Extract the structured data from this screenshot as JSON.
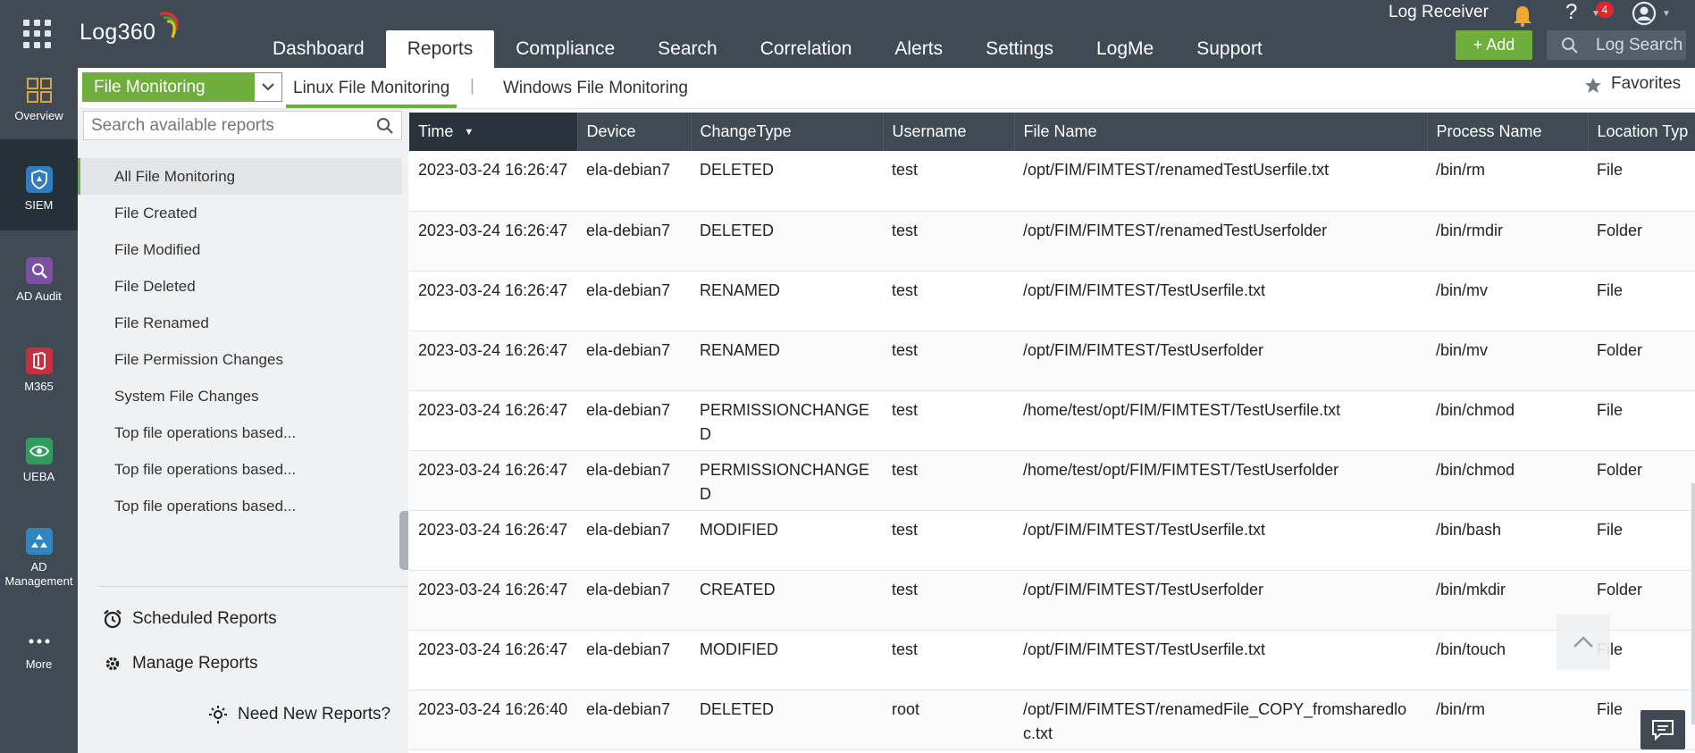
{
  "app": {
    "logo_text": "Log360"
  },
  "rail": {
    "items": [
      {
        "label": "Overview",
        "icon": "overview-icon"
      },
      {
        "label": "SIEM",
        "icon": "siem-icon"
      },
      {
        "label": "AD Audit",
        "icon": "ad-audit-icon"
      },
      {
        "label": "M365",
        "icon": "m365-icon"
      },
      {
        "label": "UEBA",
        "icon": "ueba-icon"
      },
      {
        "label": "AD\nManagement",
        "icon": "ad-management-icon"
      },
      {
        "label": "More",
        "icon": "more-icon"
      }
    ],
    "active": "SIEM"
  },
  "header": {
    "nav": [
      "Dashboard",
      "Reports",
      "Compliance",
      "Search",
      "Correlation",
      "Alerts",
      "Settings",
      "LogMe",
      "Support"
    ],
    "active_nav": "Reports",
    "log_receiver": "Log Receiver",
    "notification_count": "4",
    "help_label": "?",
    "add_label": "Add",
    "log_search_placeholder": "Log Search"
  },
  "subheader": {
    "module": "File Monitoring",
    "tabs": [
      "Linux File Monitoring",
      "Windows File Monitoring"
    ],
    "active_tab": "Linux File Monitoring",
    "favorites": "Favorites"
  },
  "report_panel": {
    "search_placeholder": "Search available reports",
    "reports": [
      "All File Monitoring",
      "File Created",
      "File Modified",
      "File Deleted",
      "File Renamed",
      "File Permission Changes",
      "System File Changes",
      "Top file operations based...",
      "Top file operations based...",
      "Top file operations based..."
    ],
    "active_report": "All File Monitoring",
    "scheduled_reports": "Scheduled Reports",
    "manage_reports": "Manage Reports",
    "need_new_reports": "Need New Reports?"
  },
  "table": {
    "columns": [
      "Time",
      "Device",
      "ChangeType",
      "Username",
      "File Name",
      "Process Name",
      "Location Typ"
    ],
    "sorted_column": "Time",
    "rows": [
      [
        "2023-03-24 16:26:47",
        "ela-debian7",
        "DELETED",
        "test",
        "/opt/FIM/FIMTEST/renamedTestUserfile.txt",
        "/bin/rm",
        "File"
      ],
      [
        "2023-03-24 16:26:47",
        "ela-debian7",
        "DELETED",
        "test",
        "/opt/FIM/FIMTEST/renamedTestUserfolder",
        "/bin/rmdir",
        "Folder"
      ],
      [
        "2023-03-24 16:26:47",
        "ela-debian7",
        "RENAMED",
        "test",
        "/opt/FIM/FIMTEST/TestUserfile.txt",
        "/bin/mv",
        "File"
      ],
      [
        "2023-03-24 16:26:47",
        "ela-debian7",
        "RENAMED",
        "test",
        "/opt/FIM/FIMTEST/TestUserfolder",
        "/bin/mv",
        "Folder"
      ],
      [
        "2023-03-24 16:26:47",
        "ela-debian7",
        "PERMISSIONCHANGED",
        "test",
        "/home/test/opt/FIM/FIMTEST/TestUserfile.txt",
        "/bin/chmod",
        "File"
      ],
      [
        "2023-03-24 16:26:47",
        "ela-debian7",
        "PERMISSIONCHANGED",
        "test",
        "/home/test/opt/FIM/FIMTEST/TestUserfolder",
        "/bin/chmod",
        "Folder"
      ],
      [
        "2023-03-24 16:26:47",
        "ela-debian7",
        "MODIFIED",
        "test",
        "/opt/FIM/FIMTEST/TestUserfile.txt",
        "/bin/bash",
        "File"
      ],
      [
        "2023-03-24 16:26:47",
        "ela-debian7",
        "CREATED",
        "test",
        "/opt/FIM/FIMTEST/TestUserfolder",
        "/bin/mkdir",
        "Folder"
      ],
      [
        "2023-03-24 16:26:47",
        "ela-debian7",
        "MODIFIED",
        "test",
        "/opt/FIM/FIMTEST/TestUserfile.txt",
        "/bin/touch",
        "File"
      ],
      [
        "2023-03-24 16:26:40",
        "ela-debian7",
        "DELETED",
        "root",
        "/opt/FIM/FIMTEST/renamedFile_COPY_fromsharedloc.txt",
        "/bin/rm",
        "File"
      ]
    ]
  },
  "colors": {
    "header_bg": "#3f4a55",
    "accent_green": "#6fae3d",
    "badge_red": "#e0252c"
  }
}
